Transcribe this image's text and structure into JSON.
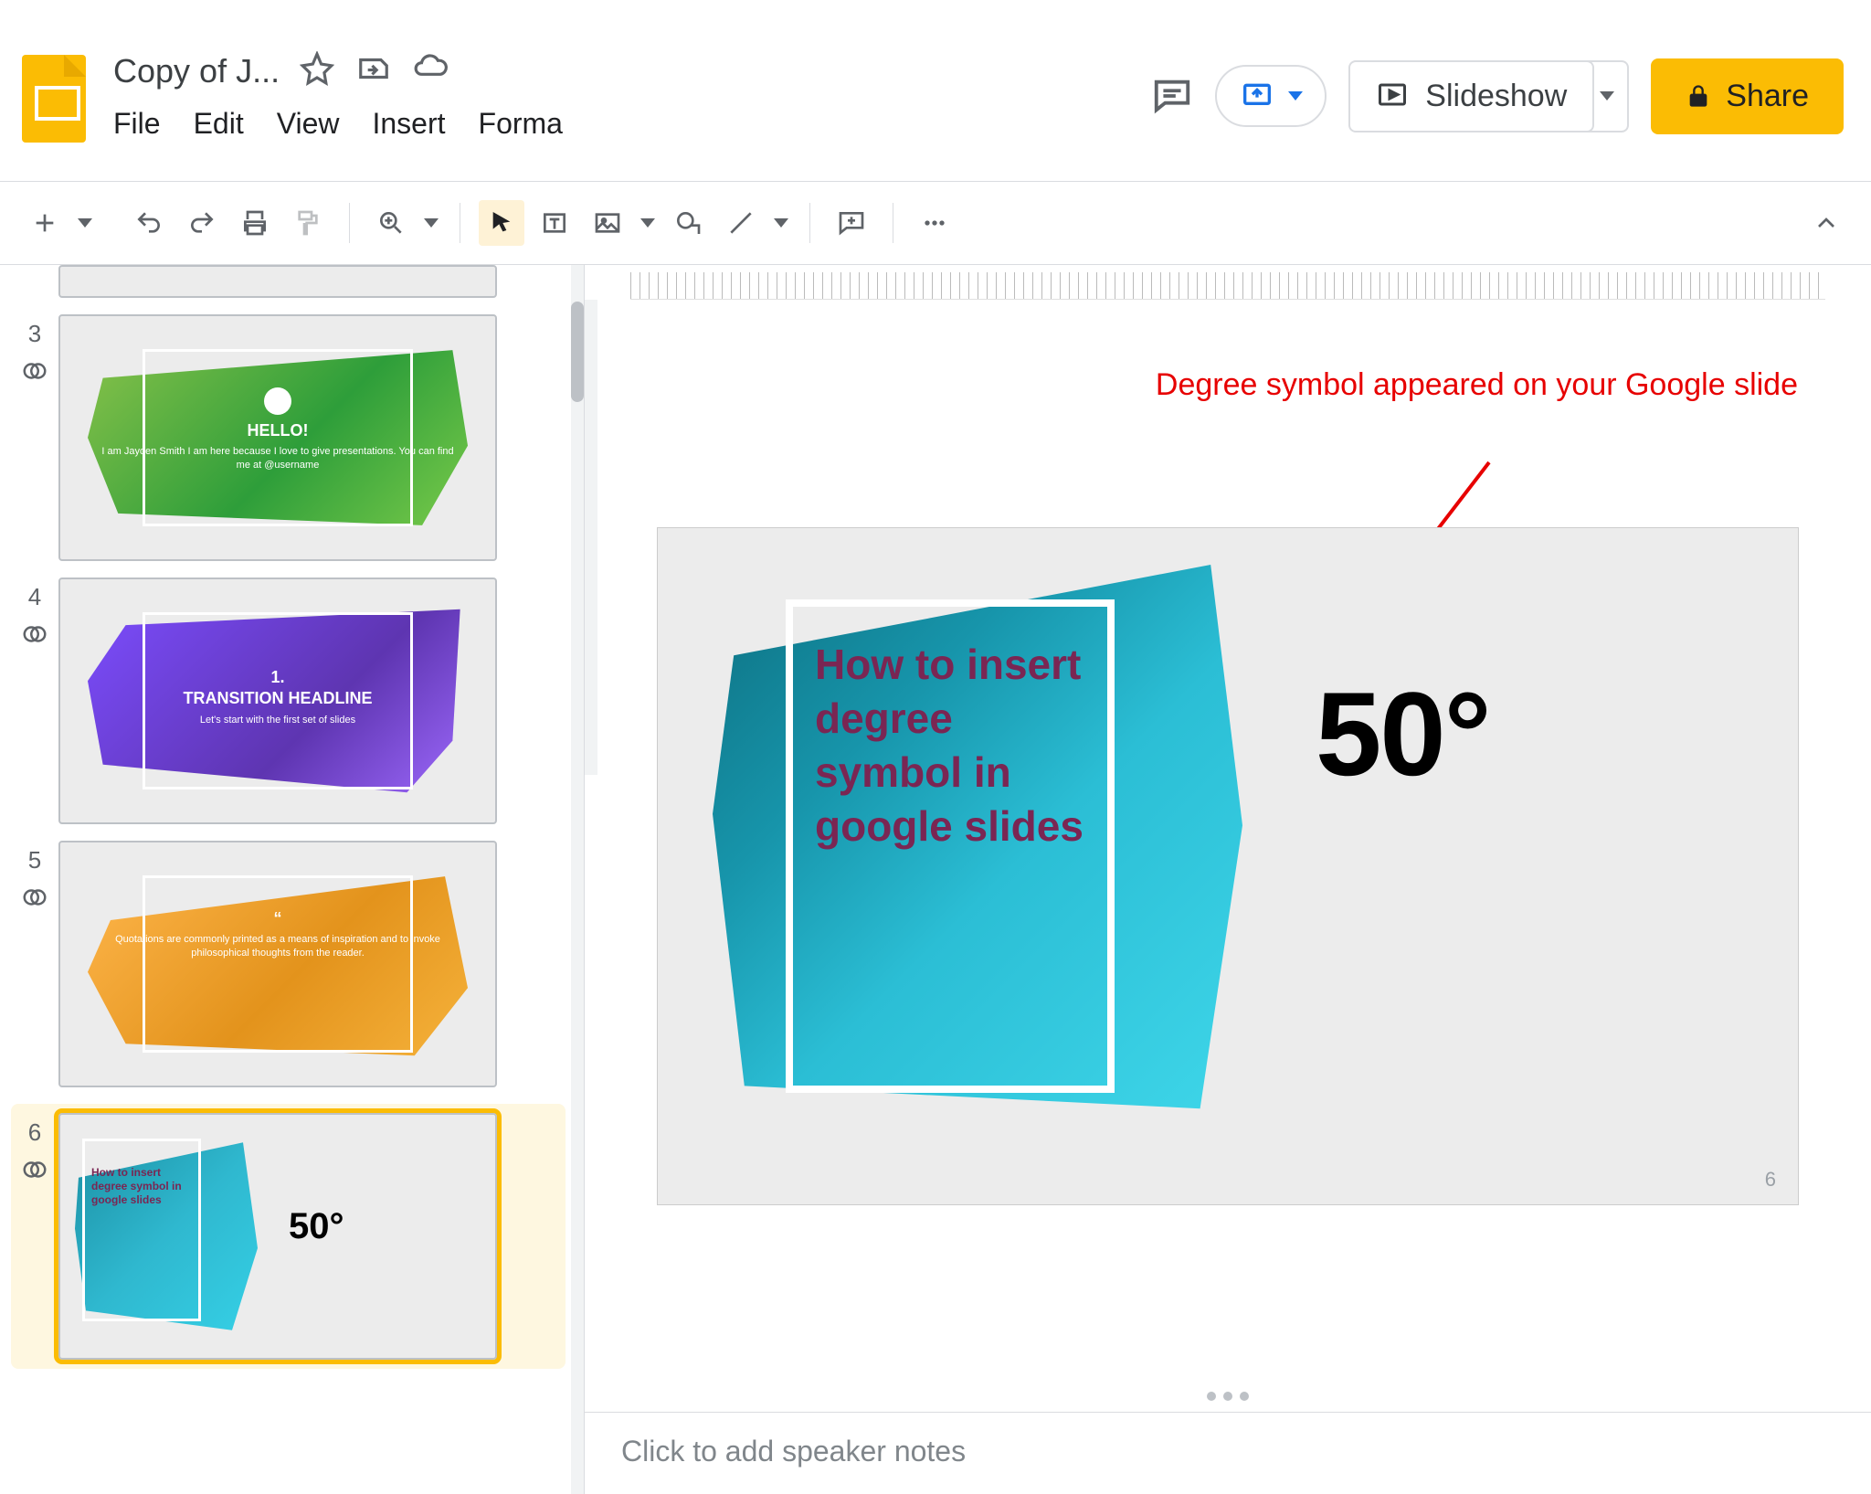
{
  "header": {
    "doc_title": "Copy of J...",
    "menus": [
      "File",
      "Edit",
      "View",
      "Insert",
      "Forma"
    ],
    "slideshow_label": "Slideshow",
    "share_label": "Share"
  },
  "toolbar": {
    "items": [
      "new-slide",
      "caret",
      "undo",
      "redo",
      "print",
      "paint-format",
      "sep",
      "zoom",
      "caret",
      "sep",
      "select",
      "textbox",
      "image",
      "caret",
      "shape",
      "line",
      "caret",
      "sep",
      "comment",
      "sep",
      "more"
    ]
  },
  "filmstrip": [
    {
      "num": "3",
      "theme": "green",
      "title": "HELLO!",
      "body": "I am Jayden Smith\nI am here because I love to give presentations.\nYou can find me at @username"
    },
    {
      "num": "4",
      "theme": "purple",
      "title": "1.\nTRANSITION HEADLINE",
      "body": "Let's start with the first set of slides"
    },
    {
      "num": "5",
      "theme": "orange",
      "title": "“",
      "body": "Quotations are commonly printed as a means of inspiration and to invoke philosophical thoughts from the reader."
    },
    {
      "num": "6",
      "theme": "blue",
      "title": "How to insert degree symbol in google slides",
      "temp": "50°"
    }
  ],
  "canvas": {
    "annotation": "Degree symbol appeared on your Google slide",
    "slide_title": "How to insert degree symbol in google slides",
    "temperature": "50°",
    "page_number": "6"
  },
  "notes_placeholder": "Click to add speaker notes"
}
